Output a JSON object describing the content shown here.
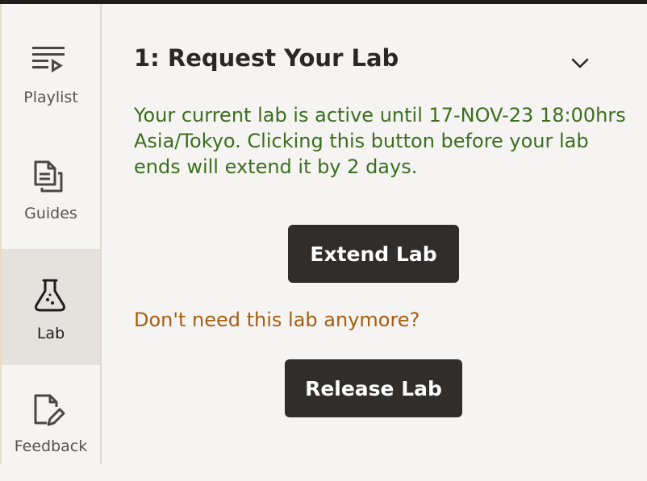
{
  "sidebar": {
    "items": [
      {
        "label": "Playlist",
        "icon": "playlist-icon",
        "active": false
      },
      {
        "label": "Guides",
        "icon": "guides-icon",
        "active": false
      },
      {
        "label": "Lab",
        "icon": "lab-flask-icon",
        "active": true
      },
      {
        "label": "Feedback",
        "icon": "feedback-icon",
        "active": false
      }
    ]
  },
  "main": {
    "section_title": "1: Request Your Lab",
    "status_message": "Your current lab is active until 17-NOV-23 18:00hrs Asia/Tokyo. Clicking this button before your lab ends will extend it by 2 days.",
    "extend_label": "Extend Lab",
    "question": "Don't need this lab anymore?",
    "release_label": "Release Lab"
  },
  "colors": {
    "status_text": "#3b6e1f",
    "question_text": "#a55e10",
    "button_bg": "#312d2a",
    "active_nav_bg": "#e5e2dd"
  }
}
